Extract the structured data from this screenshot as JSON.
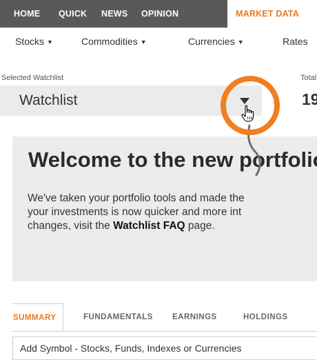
{
  "top_nav": {
    "items": [
      "HOME",
      "QUICK",
      "NEWS",
      "OPINION",
      "MARKET DATA"
    ],
    "active": "MARKET DATA"
  },
  "sub_nav": {
    "items": [
      "Stocks",
      "Commodities",
      "Currencies",
      "Rates"
    ]
  },
  "watchlist": {
    "label": "Selected Watchlist",
    "selected": "Watchlist",
    "total_label": "Total",
    "total_value": "19"
  },
  "welcome": {
    "heading": "Welcome to the new portfolio",
    "line1": "We've taken your portfolio tools and made the",
    "line2": "your investments is now quicker and more int",
    "line3_pre": "changes, visit the ",
    "line3_bold": "Watchlist FAQ",
    "line3_post": " page."
  },
  "tabs": {
    "items": [
      "SUMMARY",
      "FUNDAMENTALS",
      "EARNINGS",
      "HOLDINGS"
    ],
    "active": "SUMMARY"
  },
  "add_symbol": {
    "placeholder": "Add Symbol - Stocks, Funds, Indexes or Currencies"
  },
  "colors": {
    "accent": "#e8791f",
    "nav_bg": "#595959",
    "annotation": "#f07f1f"
  }
}
